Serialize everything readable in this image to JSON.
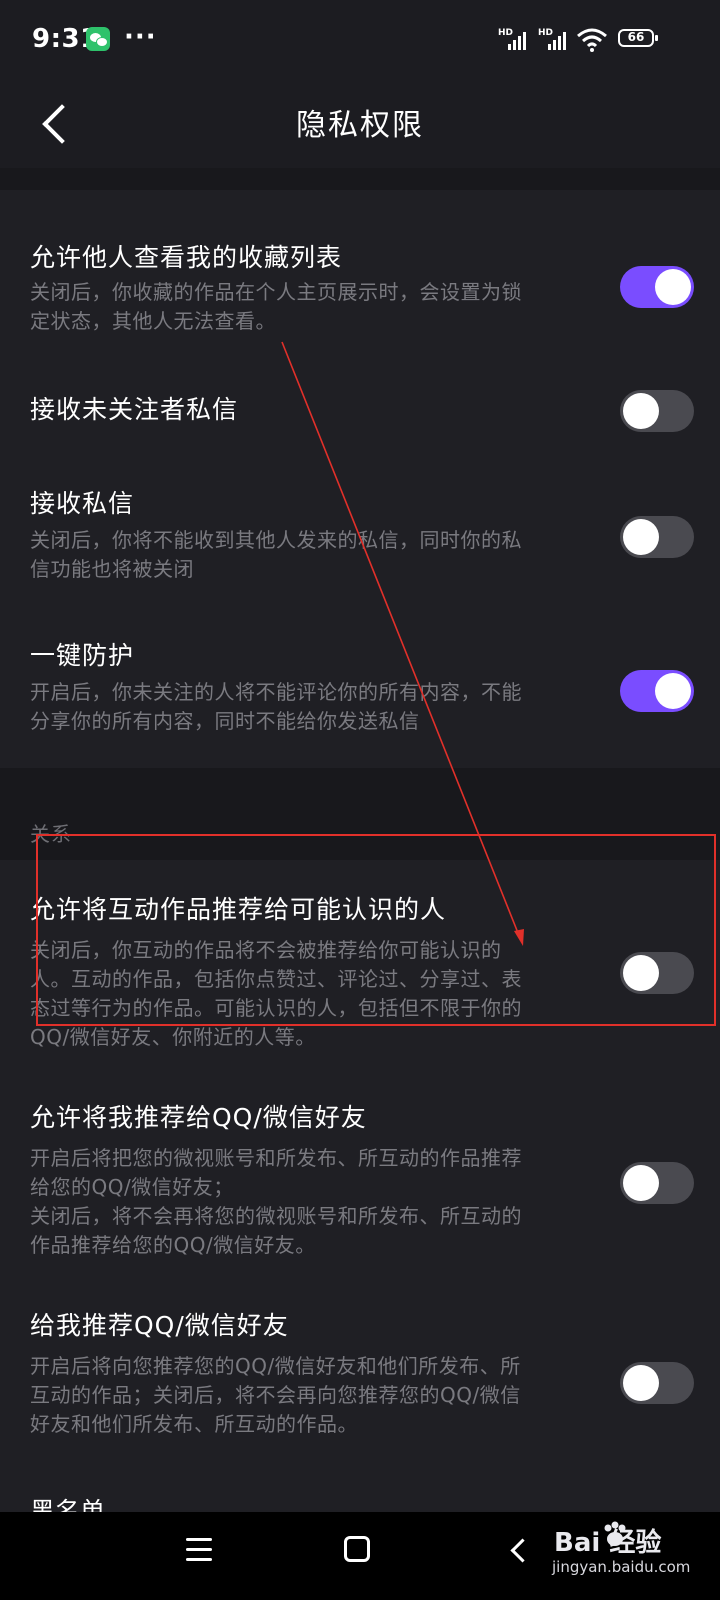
{
  "status_bar": {
    "time": "9:31",
    "notification_icons": [
      "wechat-icon",
      "more-dots-icon"
    ],
    "more": "···",
    "signal_1_label": "HD",
    "signal_2_label": "HD",
    "wifi": "wifi-icon",
    "battery": "66"
  },
  "header": {
    "title": "隐私权限",
    "back_icon": "chevron-left-icon"
  },
  "settings": {
    "items": [
      {
        "title": "允许他人查看我的收藏列表",
        "desc": "关闭后，你收藏的作品在个人主页展示时，会设置为锁\n定状态，其他人无法查看。",
        "enabled": true
      },
      {
        "title": "接收未关注者私信",
        "desc": "",
        "enabled": false
      },
      {
        "title": "接收私信",
        "desc": "关闭后，你将不能收到其他人发来的私信，同时你的私\n信功能也将被关闭",
        "enabled": false
      },
      {
        "title": "一键防护",
        "desc": "开启后，你未关注的人将不能评论你的所有内容，不能\n分享你的所有内容，同时不能给你发送私信",
        "enabled": true
      }
    ],
    "relation_header": "关系",
    "relation_items": [
      {
        "title": "允许将互动作品推荐给可能认识的人",
        "desc": "关闭后，你互动的作品将不会被推荐给你可能认识的\n人。互动的作品，包括你点赞过、评论过、分享过、表\n态过等行为的作品。可能认识的人，包括但不限于你的\nQQ/微信好友、你附近的人等。",
        "enabled": false
      },
      {
        "title": "允许将我推荐给QQ/微信好友",
        "desc": "开启后将把您的微视账号和所发布、所互动的作品推荐\n给您的QQ/微信好友；\n关闭后，将不会再将您的微视账号和所发布、所互动的\n作品推荐给您的QQ/微信好友。",
        "enabled": false
      },
      {
        "title": "给我推荐QQ/微信好友",
        "desc": "开启后将向您推荐您的QQ/微信好友和他们所发布、所\n互动的作品；关闭后，将不会再向您推荐您的QQ/微信\n好友和他们所发布、所互动的作品。",
        "enabled": false
      }
    ],
    "partial_next_title": "黑名单"
  },
  "colors": {
    "background": "#1c1c21",
    "toggle_on": "#7a4dff",
    "toggle_off": "#4a4a50",
    "annotation": "#e1302a"
  },
  "nav_bar": {
    "menu_icon": "menu-icon",
    "home_icon": "home-icon",
    "back_icon": "back-icon"
  },
  "watermark": {
    "brand": "Bai  经验",
    "url": "jingyan.baidu.com"
  }
}
